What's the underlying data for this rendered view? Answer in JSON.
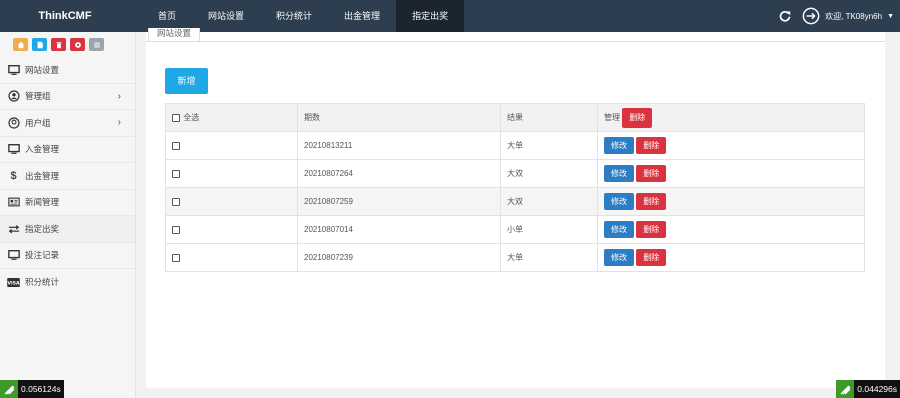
{
  "brand": "ThinkCMF",
  "nav": {
    "items": [
      {
        "label": "首页"
      },
      {
        "label": "网站设置"
      },
      {
        "label": "积分统计"
      },
      {
        "label": "出金管理"
      },
      {
        "label": "指定出奖",
        "active": true
      }
    ],
    "user_greeting": "欢迎, TK08yn6h",
    "refresh_icon": "refresh-icon",
    "logout_icon": "logout-icon"
  },
  "shortcuts": [
    {
      "icon": "home-icon",
      "color": "#f0ad4e"
    },
    {
      "icon": "file-icon",
      "color": "#1fa7e6"
    },
    {
      "icon": "trash-icon",
      "color": "#d9333f"
    },
    {
      "icon": "gear-icon",
      "color": "#d9333f"
    },
    {
      "icon": "list-icon",
      "color": "#9aa5ad"
    }
  ],
  "sidebar": {
    "items": [
      {
        "label": "网站设置",
        "icon": "desktop-icon"
      },
      {
        "label": "管理组",
        "icon": "user-circle-icon",
        "has_children": true
      },
      {
        "label": "用户组",
        "icon": "user-group-icon",
        "has_children": true
      },
      {
        "label": "入金管理",
        "icon": "desktop-icon"
      },
      {
        "label": "出金管理",
        "icon": "dollar-icon"
      },
      {
        "label": "新闻管理",
        "icon": "newspaper-icon"
      },
      {
        "label": "指定出奖",
        "icon": "exchange-icon",
        "active": true
      },
      {
        "label": "投注记录",
        "icon": "desktop-icon"
      },
      {
        "label": "积分统计",
        "icon": "visa-icon"
      }
    ]
  },
  "content": {
    "tab_label": "网站设置",
    "add_button": "新增",
    "table": {
      "headers": {
        "select_all": "全选",
        "period": "期数",
        "result": "结果",
        "manage": "管理",
        "bulk_delete": "删除"
      },
      "rows": [
        {
          "period": "20210813211",
          "result": "大单"
        },
        {
          "period": "20210807264",
          "result": "大双"
        },
        {
          "period": "20210807259",
          "result": "大双"
        },
        {
          "period": "20210807014",
          "result": "小单"
        },
        {
          "period": "20210807239",
          "result": "大单"
        }
      ],
      "edit_label": "修改",
      "delete_label": "删除"
    }
  },
  "timers": {
    "left": "0.056124s",
    "right": "0.044296s"
  },
  "colors": {
    "topbar": "#2c3e50",
    "active_nav": "#1a252f",
    "primary": "#1fa7e6",
    "edit": "#2c7ec4",
    "danger": "#d9333f"
  }
}
